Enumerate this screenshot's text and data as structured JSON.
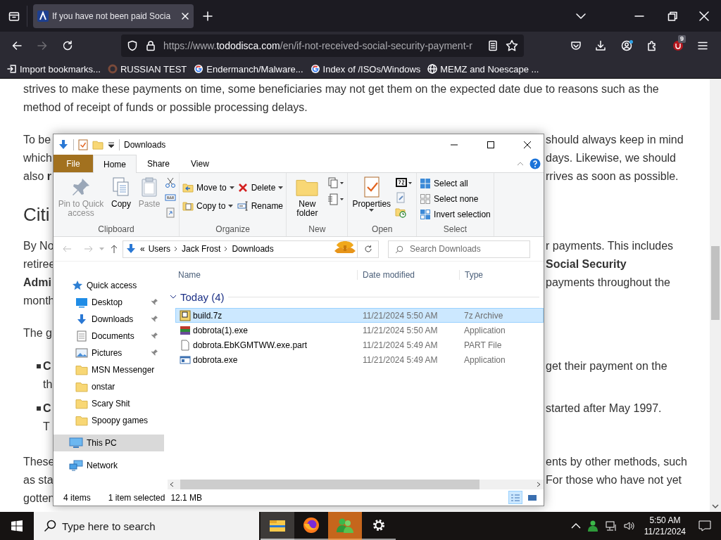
{
  "browser": {
    "tabs": [
      {
        "title": "If you have not been paid Socia",
        "selected": true
      }
    ],
    "url": {
      "prefix": "https://www.",
      "host": "tododisca.com",
      "path": "/en/if-not-received-social-security-payment-r"
    },
    "extension_badge": "9",
    "bookmarks": [
      {
        "label": "Import bookmarks...",
        "kind": "import"
      },
      {
        "label": "RUSSIAN TEST",
        "kind": "site"
      },
      {
        "label": "Endermanch/Malware...",
        "kind": "google"
      },
      {
        "label": "Index of /ISOs/Windows",
        "kind": "google"
      },
      {
        "label": "MEMZ and Noescape ...",
        "kind": "globe"
      }
    ]
  },
  "article": {
    "blocks": [
      {
        "kind": "para",
        "lines": [
          {
            "left": "strives to make these payments on time, some beneficiaries may not get them on the expected date due to reasons such as the"
          },
          {
            "left": "method of receipt of funds or possible processing delays."
          }
        ]
      },
      {
        "kind": "para",
        "lines": [
          {
            "left": "To be",
            "right": "should always keep in mind"
          },
          {
            "left": "which",
            "right": "days. Likewise, we should"
          },
          {
            "left": "also **r**",
            "right": "rrives as soon as possible."
          }
        ]
      },
      {
        "kind": "heading",
        "lines": [
          {
            "left": "Citi"
          }
        ]
      },
      {
        "kind": "para",
        "lines": [
          {
            "left": "By No",
            "right": "r payments. This includes"
          },
          {
            "left": "retiree",
            "right": "**Social Security**"
          },
          {
            "left": "**Admi**",
            "right": "payments throughout the"
          },
          {
            "left": "month"
          }
        ]
      },
      {
        "kind": "para",
        "lines": [
          {
            "left": "The g"
          }
        ]
      },
      {
        "kind": "bullet",
        "lines": [
          {
            "left": "**C**",
            "right": "get their payment on the"
          },
          {
            "left": "th"
          }
        ]
      },
      {
        "kind": "bullet",
        "lines": [
          {
            "left": "**C**",
            "right": "started after May 1997."
          },
          {
            "left": "T"
          }
        ]
      },
      {
        "kind": "para",
        "lines": [
          {
            "left": "These",
            "right": "ents by other methods, such"
          },
          {
            "left": "as sta",
            "right": "For those who have not yet"
          },
          {
            "left": "gotten"
          }
        ]
      }
    ]
  },
  "explorer": {
    "title": "Downloads",
    "ribbon_tabs": [
      {
        "label": "File",
        "kind": "file",
        "selected": false
      },
      {
        "label": "Home",
        "kind": "tab",
        "selected": true
      },
      {
        "label": "Share",
        "kind": "tab",
        "selected": false
      },
      {
        "label": "View",
        "kind": "tab",
        "selected": false
      }
    ],
    "ribbon_groups": [
      {
        "label": "Clipboard",
        "items": [
          {
            "kind": "large",
            "label": "Pin to Quick access",
            "disabled": true
          },
          {
            "kind": "large",
            "label": "Copy",
            "disabled": false
          },
          {
            "kind": "large",
            "label": "Paste",
            "disabled": true
          },
          {
            "kind": "icons"
          }
        ]
      },
      {
        "label": "Organize",
        "items": [
          {
            "kind": "column",
            "items": [
              {
                "label": "Move to",
                "dropdown": true
              },
              {
                "label": "Copy to",
                "dropdown": true
              }
            ]
          },
          {
            "kind": "column",
            "items": [
              {
                "label": "Delete",
                "dropdown": true
              },
              {
                "label": "Rename",
                "dropdown": false
              }
            ]
          }
        ]
      },
      {
        "label": "New",
        "items": [
          {
            "kind": "large",
            "label": "New folder",
            "disabled": false
          },
          {
            "kind": "icons"
          }
        ]
      },
      {
        "label": "Open",
        "items": [
          {
            "kind": "large",
            "label": "Properties",
            "disabled": false,
            "dropdown": true
          },
          {
            "kind": "icons"
          }
        ]
      },
      {
        "label": "Select",
        "items": [
          {
            "kind": "column",
            "items": [
              {
                "label": "Select all",
                "dropdown": false
              },
              {
                "label": "Select none",
                "dropdown": false
              },
              {
                "label": "Invert selection",
                "dropdown": false
              }
            ]
          }
        ]
      }
    ],
    "address": {
      "overflow": "«",
      "crumbs": [
        "Users",
        "Jack Frost",
        "Downloads"
      ]
    },
    "search": {
      "placeholder": "Search Downloads"
    },
    "nav": [
      {
        "label": "Quick access",
        "kind": "quick-access",
        "selected": false,
        "children": [
          {
            "label": "Desktop",
            "kind": "desktop",
            "pinned": true,
            "selected": false
          },
          {
            "label": "Downloads",
            "kind": "downloads",
            "pinned": true,
            "selected": false
          },
          {
            "label": "Documents",
            "kind": "documents",
            "pinned": true,
            "selected": false
          },
          {
            "label": "Pictures",
            "kind": "pictures",
            "pinned": true,
            "selected": false
          },
          {
            "label": "MSN Messenger",
            "kind": "folder",
            "pinned": false,
            "selected": false
          },
          {
            "label": "onstar",
            "kind": "folder",
            "pinned": false,
            "selected": false
          },
          {
            "label": "Scary Shit",
            "kind": "folder",
            "pinned": false,
            "selected": false
          },
          {
            "label": "Spoopy games",
            "kind": "folder",
            "pinned": false,
            "selected": false
          }
        ]
      },
      {
        "label": "This PC",
        "kind": "pc",
        "selected": true
      },
      {
        "label": "Network",
        "kind": "network",
        "selected": false
      }
    ],
    "columns": [
      "Name",
      "Date modified",
      "Type"
    ],
    "group": {
      "label": "Today (4)",
      "expanded": true
    },
    "files": [
      {
        "name": "build.7z",
        "date": "11/21/2024 5:50 AM",
        "type": "7z Archive",
        "kind": "archive",
        "selected": true
      },
      {
        "name": "dobrota(1).exe",
        "date": "11/21/2024 5:50 AM",
        "type": "Application",
        "kind": "app",
        "selected": false
      },
      {
        "name": "dobrota.EbKGMTWW.exe.part",
        "date": "11/21/2024 5:49 AM",
        "type": "PART File",
        "kind": "file",
        "selected": false
      },
      {
        "name": "dobrota.exe",
        "date": "11/21/2024 5:49 AM",
        "type": "Application",
        "kind": "exe",
        "selected": false
      }
    ],
    "status": {
      "count": "4 items",
      "selection": "1 item selected",
      "size": "12.1 MB"
    },
    "views": [
      {
        "kind": "details",
        "selected": true
      },
      {
        "kind": "tiles",
        "selected": false
      }
    ]
  },
  "taskbar": {
    "search": {
      "placeholder": "Type here to search"
    },
    "apps": [
      {
        "kind": "explorer",
        "active": true,
        "attention": false
      },
      {
        "kind": "browser",
        "active": false,
        "attention": false
      },
      {
        "kind": "messenger",
        "active": false,
        "attention": true
      },
      {
        "kind": "settings",
        "active": false,
        "attention": false
      }
    ],
    "time": "5:50 AM",
    "date": "11/21/2024"
  }
}
